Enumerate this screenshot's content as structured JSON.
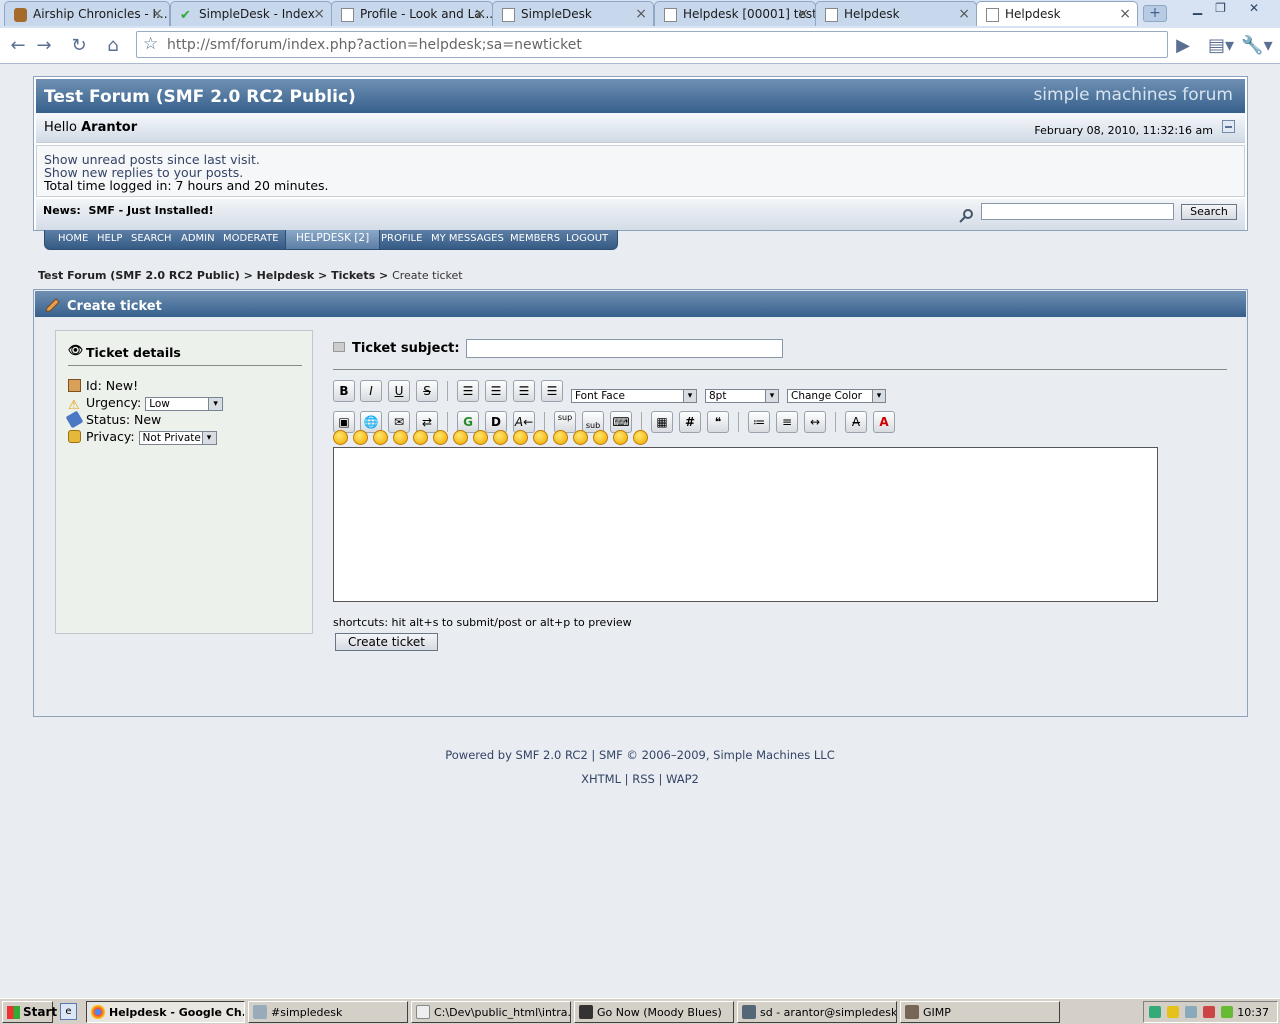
{
  "browser": {
    "tabs": [
      {
        "label": "Airship Chronicles - I...",
        "icon": "airship-icon"
      },
      {
        "label": "SimpleDesk - Index",
        "icon": "checkmark-icon"
      },
      {
        "label": "Profile - Look and La...",
        "icon": "page-icon"
      },
      {
        "label": "SimpleDesk",
        "icon": "page-icon"
      },
      {
        "label": "Helpdesk [00001] test",
        "icon": "page-icon"
      },
      {
        "label": "Helpdesk",
        "icon": "page-icon"
      },
      {
        "label": "Helpdesk",
        "icon": "page-icon"
      }
    ],
    "url": "http://smf/forum/index.php?action=helpdesk;sa=newticket"
  },
  "forum": {
    "title": "Test Forum (SMF 2.0 RC2 Public)",
    "logo_text": "simple machines forum",
    "hello": "Hello",
    "username": "Arantor",
    "date": "February 08, 2010, 11:32:16 am",
    "unread_link": "Show unread posts since last visit.",
    "replies_link": "Show new replies to your posts.",
    "time_logged": "Total time logged in: 7 hours and 20 minutes.",
    "news_label": "News:",
    "news_text": "SMF - Just Installed!",
    "search_button": "Search"
  },
  "menu": {
    "home": "HOME",
    "help": "HELP",
    "search": "SEARCH",
    "admin": "ADMIN",
    "moderate": "MODERATE",
    "helpdesk": "HELPDESK [2]",
    "profile": "PROFILE",
    "messages": "MY MESSAGES",
    "members": "MEMBERS",
    "logout": "LOGOUT"
  },
  "breadcrumb": {
    "forum": "Test Forum (SMF 2.0 RC2 Public)",
    "sep": ">",
    "helpdesk": "Helpdesk",
    "tickets": "Tickets",
    "current": "Create ticket"
  },
  "ticket": {
    "panel_title": "Create ticket",
    "details_title": "Ticket details",
    "id_label": "Id: New!",
    "urgency_label": "Urgency:",
    "urgency_value": "Low",
    "status_label": "Status: New",
    "privacy_label": "Privacy:",
    "privacy_value": "Not Private",
    "subject_label": "Ticket subject:",
    "subject_value": "",
    "font_face": "Font Face",
    "font_size": "8pt",
    "change_color": "Change Color",
    "sup": "sup",
    "sub": "sub",
    "shortcuts": "shortcuts: hit alt+s to submit/post or alt+p to preview",
    "submit": "Create ticket"
  },
  "footer": {
    "powered": "Powered by SMF 2.0 RC2 | SMF © 2006–2009, Simple Machines LLC",
    "xhtml": "XHTML",
    "rss": "RSS",
    "wap2": "WAP2",
    "bar": "|"
  },
  "taskbar": {
    "start": "Start",
    "tasks": [
      "Helpdesk - Google Ch...",
      "#simpledesk",
      "C:\\Dev\\public_html\\intra...",
      "Go Now (Moody Blues)",
      "sd - arantor@simpledesk...",
      "GIMP"
    ],
    "clock": "10:37"
  },
  "colors": {
    "header_blue": "#36608c",
    "link": "#334466",
    "page_bg": "#e9ecf1",
    "details_bg": "#ecf1ec"
  }
}
